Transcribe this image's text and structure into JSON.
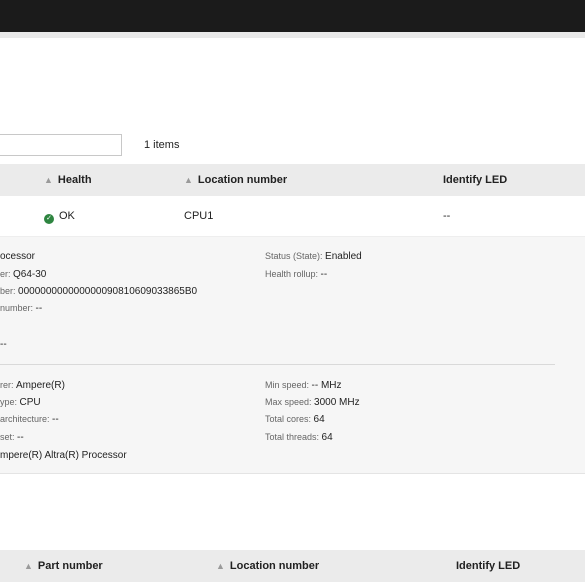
{
  "filter": {
    "value": "",
    "placeholder": ""
  },
  "items_count": "1 items",
  "table1": {
    "sort_icon": "sort-icon",
    "headers": {
      "health": "Health",
      "location": "Location number",
      "identify_led": "Identify LED"
    },
    "row": {
      "health": "OK",
      "location": "CPU1",
      "identify_led": "--"
    }
  },
  "details": {
    "left": [
      {
        "key": "",
        "value": "ocessor"
      },
      {
        "key": "er: ",
        "value": "Q64-30"
      },
      {
        "key": "ber: ",
        "value": "000000000000000090810609033865B0"
      },
      {
        "key": "number: ",
        "value": "--"
      },
      {
        "key": "",
        "value": "--"
      }
    ],
    "right": [
      {
        "key": "Status (State): ",
        "value": "Enabled"
      },
      {
        "key": "Health rollup: ",
        "value": "--"
      }
    ],
    "left2": [
      {
        "key": "rer: ",
        "value": "Ampere(R)"
      },
      {
        "key": "ype: ",
        "value": "CPU"
      },
      {
        "key": "architecture: ",
        "value": "--"
      },
      {
        "key": " set: ",
        "value": "--"
      },
      {
        "key": "",
        "value": "mpere(R) Altra(R) Processor"
      }
    ],
    "right2": [
      {
        "key": "Min speed: ",
        "value": "-- MHz"
      },
      {
        "key": "Max speed: ",
        "value": "3000 MHz"
      },
      {
        "key": "Total cores: ",
        "value": "64"
      },
      {
        "key": "Total threads: ",
        "value": "64"
      }
    ]
  },
  "table2": {
    "headers": {
      "part_number": "Part number",
      "location": "Location number",
      "identify_led": "Identify LED"
    }
  },
  "colors": {
    "ok": "#2e8540",
    "topbar": "#1b1b1b",
    "header_bg": "#ebebeb"
  }
}
